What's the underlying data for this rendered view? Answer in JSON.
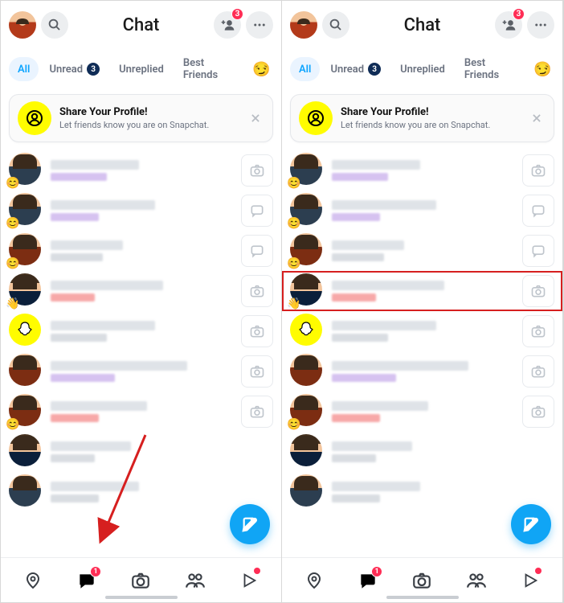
{
  "left_panel": {
    "header": {
      "title": "Chat",
      "add_badge": "3"
    },
    "filters": {
      "all": "All",
      "unread": "Unread",
      "unread_count": "3",
      "unreplied": "Unreplied",
      "best_friends": "Best Friends",
      "emoji": "😏"
    },
    "share": {
      "title": "Share Your Profile!",
      "subtitle": "Let friends know you are on Snapchat."
    },
    "nav_chat_badge": "1",
    "rows": [
      {
        "avatar": "bitmoji-m",
        "emoji": "😊",
        "name_w": 110,
        "sub_w": 70,
        "sub": "purple",
        "action": "camera"
      },
      {
        "avatar": "bitmoji-m",
        "emoji": "😊",
        "name_w": 130,
        "sub_w": 60,
        "sub": "purple",
        "action": "chat"
      },
      {
        "avatar": "bitmoji-m2",
        "emoji": "😊",
        "name_w": 90,
        "sub_w": 65,
        "sub": "gray",
        "action": "chat"
      },
      {
        "avatar": "bitmoji-f",
        "emoji": "👋",
        "name_w": 140,
        "sub_w": 55,
        "sub": "red",
        "action": "camera"
      },
      {
        "avatar": "ghost",
        "emoji": "",
        "name_w": 130,
        "sub_w": 70,
        "sub": "gray",
        "action": "camera"
      },
      {
        "avatar": "bitmoji-m2",
        "emoji": "",
        "name_w": 170,
        "sub_w": 80,
        "sub": "purple",
        "action": "camera"
      },
      {
        "avatar": "bitmoji-m2",
        "emoji": "😊",
        "name_w": 120,
        "sub_w": 60,
        "sub": "red",
        "action": "camera"
      },
      {
        "avatar": "bitmoji-f",
        "emoji": "",
        "name_w": 100,
        "sub_w": 55,
        "sub": "gray",
        "action": ""
      },
      {
        "avatar": "bitmoji-m",
        "emoji": "",
        "name_w": 110,
        "sub_w": 60,
        "sub": "gray",
        "action": ""
      }
    ],
    "arrow": true
  },
  "right_panel": {
    "header": {
      "title": "Chat",
      "add_badge": "3"
    },
    "filters": {
      "all": "All",
      "unread": "Unread",
      "unread_count": "3",
      "unreplied": "Unreplied",
      "best_friends": "Best Friends",
      "emoji": "😏"
    },
    "share": {
      "title": "Share Your Profile!",
      "subtitle": "Let friends know you are on Snapchat."
    },
    "nav_chat_badge": "1",
    "rows": [
      {
        "avatar": "bitmoji-m",
        "emoji": "😊",
        "name_w": 110,
        "sub_w": 70,
        "sub": "purple",
        "action": "camera"
      },
      {
        "avatar": "bitmoji-m",
        "emoji": "😊",
        "name_w": 130,
        "sub_w": 60,
        "sub": "purple",
        "action": "chat"
      },
      {
        "avatar": "bitmoji-m2",
        "emoji": "😊",
        "name_w": 90,
        "sub_w": 65,
        "sub": "gray",
        "action": "chat"
      },
      {
        "avatar": "bitmoji-f",
        "emoji": "👋",
        "name_w": 140,
        "sub_w": 55,
        "sub": "red",
        "action": "camera",
        "highlight": true
      },
      {
        "avatar": "ghost",
        "emoji": "",
        "name_w": 130,
        "sub_w": 70,
        "sub": "gray",
        "action": "camera"
      },
      {
        "avatar": "bitmoji-m2",
        "emoji": "",
        "name_w": 170,
        "sub_w": 80,
        "sub": "purple",
        "action": "camera"
      },
      {
        "avatar": "bitmoji-m2",
        "emoji": "😊",
        "name_w": 120,
        "sub_w": 60,
        "sub": "red",
        "action": "camera"
      },
      {
        "avatar": "bitmoji-f",
        "emoji": "",
        "name_w": 100,
        "sub_w": 55,
        "sub": "gray",
        "action": ""
      },
      {
        "avatar": "bitmoji-m",
        "emoji": "",
        "name_w": 110,
        "sub_w": 60,
        "sub": "gray",
        "action": ""
      }
    ],
    "arrow": false
  }
}
